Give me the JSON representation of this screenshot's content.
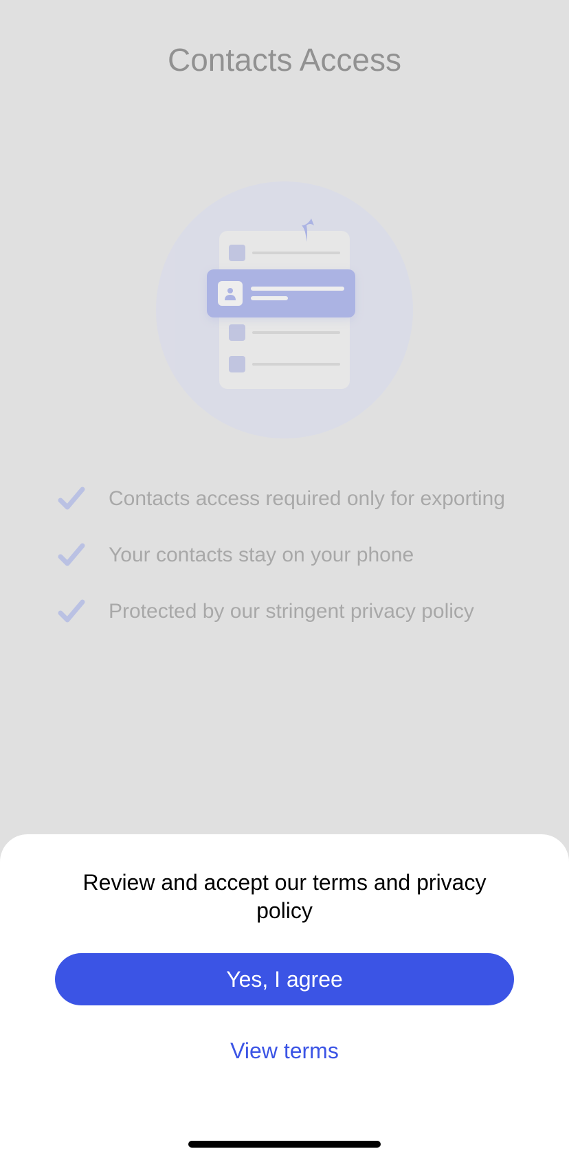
{
  "header": {
    "title": "Contacts Access"
  },
  "features": [
    {
      "text": "Contacts access required only for exporting"
    },
    {
      "text": "Your contacts stay on your phone"
    },
    {
      "text": "Protected by our stringent privacy policy"
    }
  ],
  "sheet": {
    "title": "Review and accept our terms and privacy policy",
    "agree_label": "Yes, I agree",
    "terms_label": "View terms"
  }
}
